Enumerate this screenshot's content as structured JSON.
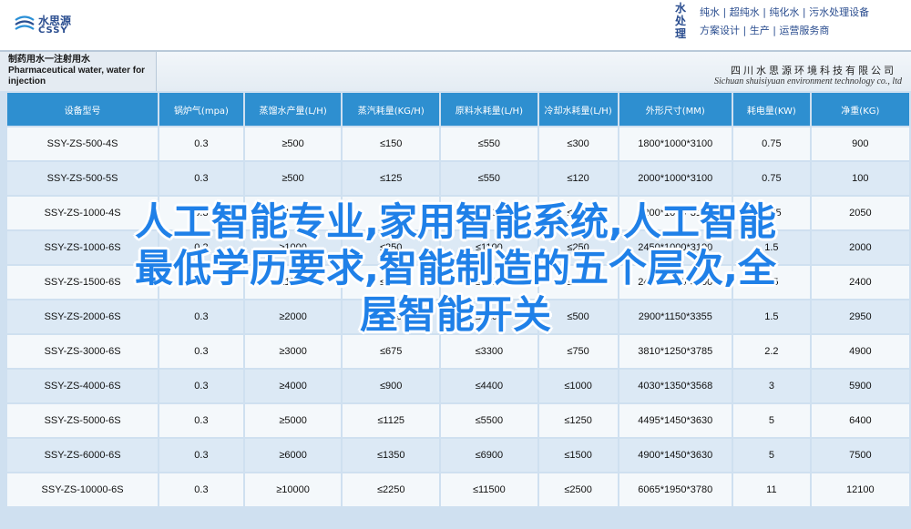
{
  "header": {
    "logo_cn": "水思源",
    "logo_en": "CSSY",
    "brand_vertical": [
      "水",
      "处",
      "理"
    ],
    "services": [
      "纯水 | 超纯水 | 纯化水 | 污水处理设备",
      "方案设计 | 生产 | 运营服务商"
    ]
  },
  "title": {
    "lines": [
      "制药用水一注射用水",
      "Pharmaceutical water, water for",
      "injection"
    ],
    "company_cn": "四川水思源环境科技有限公司",
    "company_en": "Sichuan shuisiyuan environment technology co., ltd"
  },
  "table": {
    "headers": [
      "设备型号",
      "锅炉气(mpa)",
      "蒸馏水产量(L/H)",
      "蒸汽耗量(KG/H)",
      "原料水耗量(L/H)",
      "冷却水耗量(L/H)",
      "外形尺寸(MM)",
      "耗电量(KW)",
      "净重(KG)"
    ],
    "rows": [
      [
        "SSY-ZS-500-4S",
        "0.3",
        "≥500",
        "≤150",
        "≤550",
        "≤300",
        "1800*1000*3100",
        "0.75",
        "900"
      ],
      [
        "SSY-ZS-500-5S",
        "0.3",
        "≥500",
        "≤125",
        "≤550",
        "≤120",
        "2000*1000*3100",
        "0.75",
        "100"
      ],
      [
        "SSY-ZS-1000-4S",
        "0.3",
        "≥1000",
        "≤300",
        "≤1100",
        "≤600",
        "2200*1000*3100",
        "0.75",
        "2050"
      ],
      [
        "SSY-ZS-1000-6S",
        "0.3",
        "≥1000",
        "≤250",
        "≤1100",
        "≤250",
        "2450*1000*3100",
        "1.5",
        "2000"
      ],
      [
        "SSY-ZS-1500-6S",
        "0.3",
        "≥1500",
        "≤375",
        "≤1650",
        "≤375",
        "2450*1000*3100",
        "1.5",
        "2400"
      ],
      [
        "SSY-ZS-2000-6S",
        "0.3",
        "≥2000",
        "≤450",
        "≤2200",
        "≤500",
        "2900*1150*3355",
        "1.5",
        "2950"
      ],
      [
        "SSY-ZS-3000-6S",
        "0.3",
        "≥3000",
        "≤675",
        "≤3300",
        "≤750",
        "3810*1250*3785",
        "2.2",
        "4900"
      ],
      [
        "SSY-ZS-4000-6S",
        "0.3",
        "≥4000",
        "≤900",
        "≤4400",
        "≤1000",
        "4030*1350*3568",
        "3",
        "5900"
      ],
      [
        "SSY-ZS-5000-6S",
        "0.3",
        "≥5000",
        "≤1125",
        "≤5500",
        "≤1250",
        "4495*1450*3630",
        "5",
        "6400"
      ],
      [
        "SSY-ZS-6000-6S",
        "0.3",
        "≥6000",
        "≤1350",
        "≤6900",
        "≤1500",
        "4900*1450*3630",
        "5",
        "7500"
      ],
      [
        "SSY-ZS-10000-6S",
        "0.3",
        "≥10000",
        "≤2250",
        "≤11500",
        "≤2500",
        "6065*1950*3780",
        "11",
        "12100"
      ]
    ]
  },
  "overlay": {
    "lines": [
      "人工智能专业,家用智能系统,人工智能",
      "最低学历要求,智能制造的五个层次,全",
      "屋智能开关"
    ]
  },
  "colors": {
    "header_blue": "#2e8fd0",
    "brand_blue": "#2a4d8f",
    "overlay_blue": "#1f80e8"
  }
}
